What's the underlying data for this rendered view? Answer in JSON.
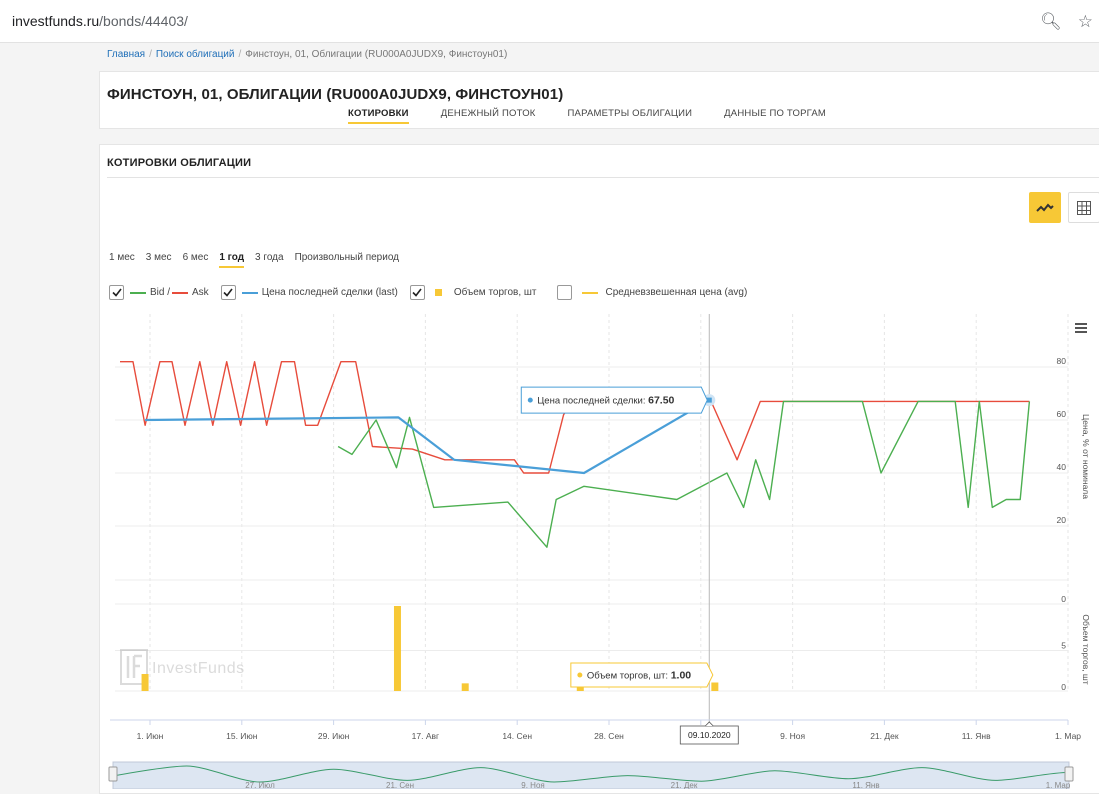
{
  "browser": {
    "url_host": "investfunds.ru",
    "url_path": "/bonds/44403/"
  },
  "breadcrumb": {
    "home": "Главная",
    "search": "Поиск облигаций",
    "current": "Финстоун, 01, Облигации (RU000A0JUDX9, Финстоун01)"
  },
  "header": {
    "title": "ФИНСТОУН, 01, ОБЛИГАЦИИ (RU000A0JUDX9, ФИНСТОУН01)",
    "tabs": [
      "КОТИРОВКИ",
      "ДЕНЕЖНЫЙ ПОТОК",
      "ПАРАМЕТРЫ ОБЛИГАЦИИ",
      "ДАННЫЕ ПО ТОРГАМ"
    ],
    "active_tab": 0
  },
  "section": {
    "title": "КОТИРОВКИ ОБЛИГАЦИИ"
  },
  "periods": {
    "items": [
      "1 мес",
      "3 мес",
      "6 мес",
      "1 год",
      "3 года",
      "Произвольный период"
    ],
    "active": 3
  },
  "legend": {
    "bid": "Bid /",
    "ask": "Ask",
    "last": "Цена последней сделки (last)",
    "volume": "Объем торгов, шт",
    "avg": "Средневзвешенная цена (avg)"
  },
  "colors": {
    "bid": "#4caf50",
    "ask": "#e74c3c",
    "last": "#4a9fd8",
    "volume": "#f7c836",
    "avg": "#f7c836"
  },
  "chart_data": {
    "type": "line",
    "x_tick_labels": [
      "1. Июн",
      "15. Июн",
      "29. Июн",
      "17. Авг",
      "14. Сен",
      "28. Сен",
      "5. Окт",
      "9. Ноя",
      "21. Дек",
      "11. Янв",
      "1. Мар"
    ],
    "ylabel": "Цена, % от номинала",
    "ylim": [
      0,
      100
    ],
    "yticks": [
      20,
      40,
      60,
      80
    ],
    "volume_ylabel": "Объем торгов, шт",
    "volume_yticks": [
      0,
      5,
      0
    ],
    "series": [
      {
        "name": "Ask",
        "points": [
          [
            0.0,
            82
          ],
          [
            0.014,
            82
          ],
          [
            0.027,
            58
          ],
          [
            0.043,
            82
          ],
          [
            0.056,
            82
          ],
          [
            0.07,
            58
          ],
          [
            0.086,
            82
          ],
          [
            0.1,
            58
          ],
          [
            0.115,
            82
          ],
          [
            0.13,
            58
          ],
          [
            0.145,
            82
          ],
          [
            0.158,
            58
          ],
          [
            0.174,
            82
          ],
          [
            0.188,
            82
          ],
          [
            0.2,
            58
          ],
          [
            0.213,
            58
          ],
          [
            0.238,
            82
          ],
          [
            0.254,
            82
          ],
          [
            0.272,
            50
          ],
          [
            0.315,
            49
          ],
          [
            0.35,
            45
          ],
          [
            0.385,
            45
          ],
          [
            0.425,
            45
          ],
          [
            0.435,
            40
          ],
          [
            0.462,
            40
          ],
          [
            0.478,
            62
          ],
          [
            0.487,
            67
          ],
          [
            0.535,
            67
          ],
          [
            0.57,
            67
          ],
          [
            0.637,
            67
          ],
          [
            0.665,
            45
          ],
          [
            0.69,
            67
          ],
          [
            0.72,
            67
          ],
          [
            0.8,
            67
          ],
          [
            0.87,
            67
          ],
          [
            0.93,
            67
          ],
          [
            0.98,
            67
          ]
        ]
      },
      {
        "name": "Bid",
        "points": [
          [
            0.235,
            50
          ],
          [
            0.25,
            47
          ],
          [
            0.276,
            60
          ],
          [
            0.298,
            42
          ],
          [
            0.312,
            61
          ],
          [
            0.338,
            27
          ],
          [
            0.418,
            29
          ],
          [
            0.46,
            12
          ],
          [
            0.47,
            30
          ],
          [
            0.5,
            35
          ],
          [
            0.6,
            30
          ],
          [
            0.654,
            40
          ],
          [
            0.672,
            27
          ],
          [
            0.685,
            45
          ],
          [
            0.7,
            30
          ],
          [
            0.715,
            67
          ],
          [
            0.8,
            67
          ],
          [
            0.82,
            40
          ],
          [
            0.86,
            67
          ],
          [
            0.9,
            67
          ],
          [
            0.914,
            27
          ],
          [
            0.926,
            67
          ],
          [
            0.94,
            27
          ],
          [
            0.955,
            30
          ],
          [
            0.97,
            30
          ],
          [
            0.98,
            67
          ]
        ]
      },
      {
        "name": "Цена последней сделки (last)",
        "points": [
          [
            0.027,
            60
          ],
          [
            0.3,
            61
          ],
          [
            0.36,
            45
          ],
          [
            0.5,
            40
          ],
          [
            0.635,
            67.5
          ]
        ]
      },
      {
        "name": "Объем торгов, шт",
        "type": "bar",
        "points": [
          [
            0.027,
            0.2
          ],
          [
            0.299,
            1.0
          ],
          [
            0.372,
            0.09
          ],
          [
            0.496,
            0.1
          ],
          [
            0.641,
            0.1
          ]
        ]
      }
    ],
    "tooltip_last": {
      "label": "Цена последней сделки:",
      "value": "67.50"
    },
    "tooltip_volume": {
      "label": "Объем торгов, шт:",
      "value": "1.00"
    },
    "crosshair_date": "09.10.2020",
    "navigator_labels": [
      "27. Июл",
      "21. Сен",
      "9. Ноя",
      "21. Дек",
      "11. Янв",
      "1. Мар"
    ]
  },
  "watermark": "InvestFunds"
}
